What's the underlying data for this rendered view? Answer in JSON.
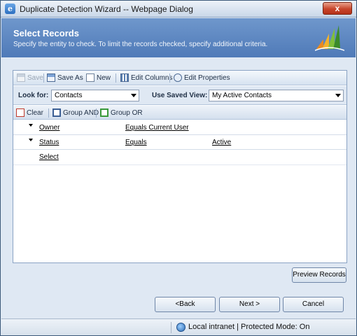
{
  "window": {
    "title": "Duplicate Detection Wizard -- Webpage Dialog",
    "close_label": "x"
  },
  "header": {
    "title": "Select Records",
    "subtitle": "Specify the entity to check. To limit the records checked, specify additional criteria."
  },
  "toolbar": {
    "save_label": "Save",
    "save_as_label": "Save As",
    "new_label": "New",
    "edit_columns_label": "Edit Columns",
    "edit_properties_label": "Edit Properties"
  },
  "lookfor": {
    "label": "Look for:",
    "value": "Contacts",
    "saved_view_label": "Use Saved View:",
    "saved_view_value": "My Active Contacts"
  },
  "actions": {
    "clear_label": "Clear",
    "group_and_label": "Group AND",
    "group_or_label": "Group OR"
  },
  "criteria": {
    "rows": [
      {
        "field": "Owner",
        "operator": "Equals Current User",
        "value": ""
      },
      {
        "field": "Status",
        "operator": "Equals",
        "value": "Active"
      }
    ],
    "select_label": "Select"
  },
  "buttons": {
    "preview": "Preview Records",
    "back": "<Back",
    "next": "Next >",
    "cancel": "Cancel"
  },
  "status": {
    "text": "Local intranet | Protected Mode: On"
  },
  "colors": {
    "header_bg": "#5a84bf",
    "accent": "#4f7ab8"
  }
}
